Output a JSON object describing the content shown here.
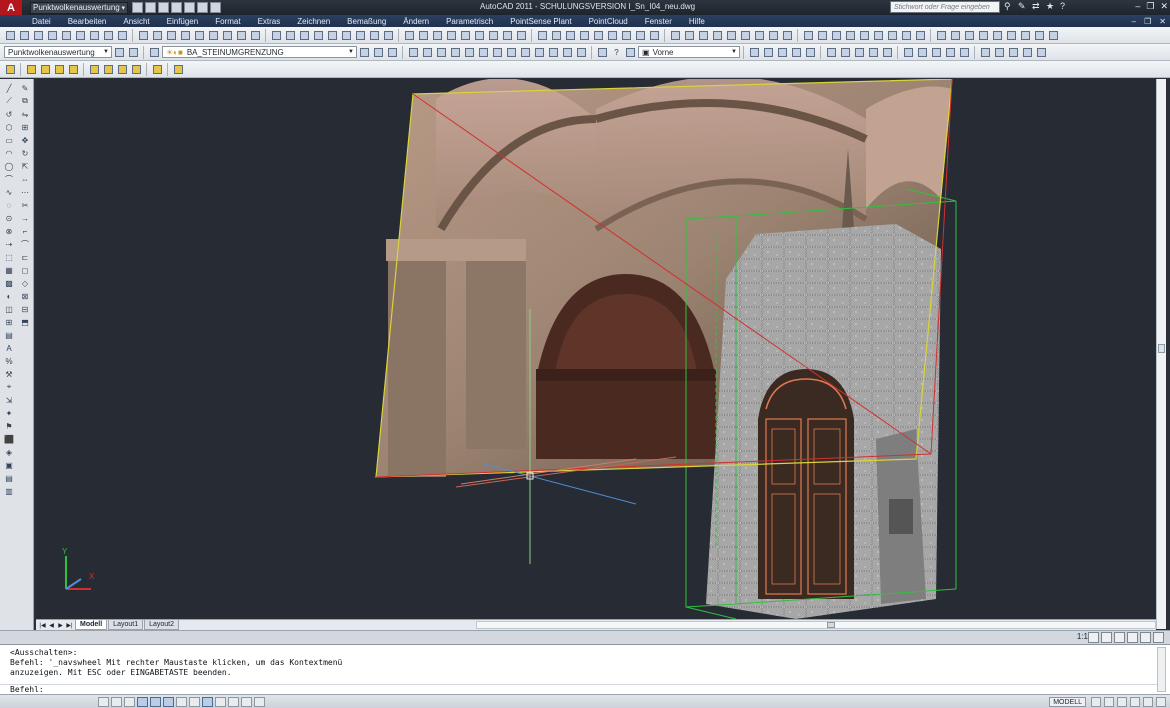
{
  "app": {
    "logo": "A",
    "workspace": "Punktwolkenauswertung",
    "window_title": "AutoCAD 2011 - SCHULUNGSVERSION    I_Sn_I04_neu.dwg",
    "search_placeholder": "Stichwort oder Frage eingeben"
  },
  "menu": [
    "Datei",
    "Bearbeiten",
    "Ansicht",
    "Einfügen",
    "Format",
    "Extras",
    "Zeichnen",
    "Bemaßung",
    "Ändern",
    "Parametrisch",
    "PointSense Plant",
    "PointCloud",
    "Fenster",
    "Hilfe"
  ],
  "toolbar2": {
    "workspace_combo": "Punktwolkenauswertung",
    "layer_combo": "BA_STEINUMGRENZUNG",
    "view_combo": "Vorne"
  },
  "tabs": {
    "model": "Modell",
    "layout1": "Layout1",
    "layout2": "Layout2"
  },
  "annotation": {
    "scale": "1:1"
  },
  "command": {
    "lines": [
      "<Ausschalten>:",
      "Befehl: '_navswheel Mit rechter Maustaste klicken, um das Kontextmenü",
      "anzuzeigen. Mit ESC oder EINGABETASTE beenden."
    ],
    "prompt": "Befehl:"
  },
  "status": {
    "model_button": "MODELL"
  },
  "ucs": {
    "x_label": "X",
    "y_label": "Y"
  },
  "colors": {
    "viewport_bg": "#272b33",
    "boundary_yellow": "#d8d43a",
    "line_red": "#d23030",
    "box_green": "#31c040"
  }
}
